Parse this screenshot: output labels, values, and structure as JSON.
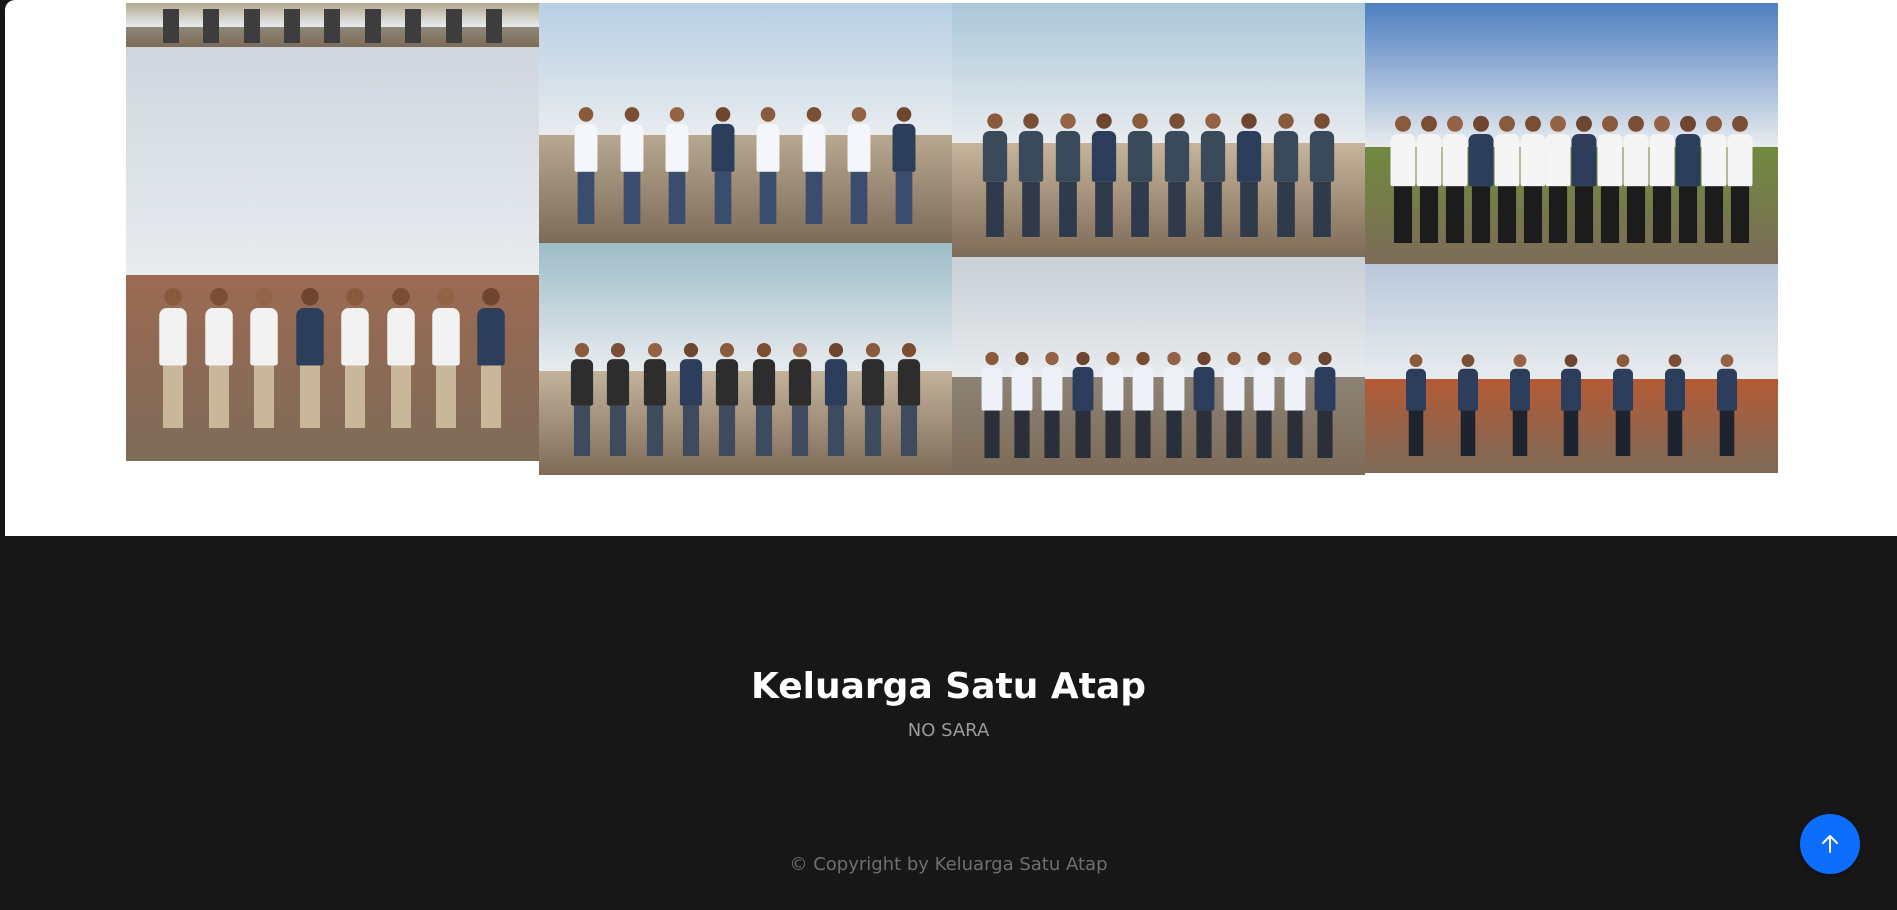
{
  "footer": {
    "title": "Keluarga Satu Atap",
    "subtitle": "NO SARA",
    "copyright": "© Copyright by Keluarga Satu Atap"
  },
  "colors": {
    "footer_bg": "#171717",
    "accent": "#0d6efd",
    "page_bg": "#ffffff"
  },
  "gallery": {
    "photos": [
      {
        "name": "group-photo-wall-steps",
        "sky": "#cfd6de",
        "ground": "#9c6a52",
        "shirt": "#f2f2f2",
        "pants": "#c9b79a",
        "count": 8
      },
      {
        "name": "group-photo-lakeside-top",
        "sky": "#b8cfe4",
        "ground": "#b8a890",
        "shirt": "#f4f6fb",
        "pants": "#3b4d6e",
        "count": 8
      },
      {
        "name": "group-photo-tree-top",
        "sky": "#aac7d8",
        "ground": "#c7b49b",
        "shirt": "#3a4a5a",
        "pants": "#2f3b4a",
        "count": 10
      },
      {
        "name": "group-photo-field-large",
        "sky": "#4d7ec0",
        "ground": "#6f8a3e",
        "shirt": "#f5f5f5",
        "pants": "#1c1c1c",
        "count": 14
      },
      {
        "name": "group-photo-tree-bottom",
        "sky": "#9cbcc8",
        "ground": "#c4b39b",
        "shirt": "#2d2d2d",
        "pants": "#3e4a5e",
        "count": 10
      },
      {
        "name": "group-photo-plaza",
        "sky": "#c9cfd4",
        "ground": "#8c8274",
        "shirt": "#eef2f8",
        "pants": "#2a2f3a",
        "count": 12
      },
      {
        "name": "group-photo-rooftop",
        "sky": "#b9c8db",
        "ground": "#b45a36",
        "shirt": "#2c3e5c",
        "pants": "#1d2430",
        "count": 7
      },
      {
        "name": "group-photo-top-strip",
        "sky": "#b4a88e",
        "ground": "#8f8878",
        "shirt": "#2a2a2a",
        "pants": "#3d3d3d",
        "count": 9
      }
    ]
  }
}
